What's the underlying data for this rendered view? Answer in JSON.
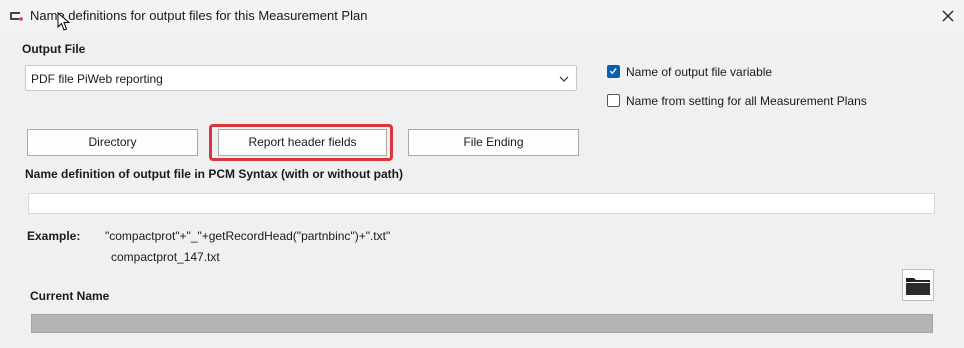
{
  "window": {
    "title": "Name definitions for output files for this Measurement Plan"
  },
  "output_file": {
    "label": "Output File",
    "selected": "PDF file PiWeb reporting"
  },
  "options": {
    "variable_label": "Name of output file variable",
    "variable_checked": true,
    "global_label": "Name from setting for all Measurement Plans",
    "global_checked": false
  },
  "buttons": {
    "directory": "Directory",
    "report_header": "Report header fields",
    "file_ending": "File Ending"
  },
  "definition": {
    "label": "Name definition of output file in PCM Syntax (with or without path)",
    "value": ""
  },
  "example": {
    "label": "Example:",
    "syntax": "\"compactprot\"+\"_\"+getRecordHead(\"partnbinc\")+\".txt\"",
    "result": "compactprot_147.txt"
  },
  "current_name": {
    "label": "Current Name",
    "value": ""
  },
  "colors": {
    "highlight": "#d9363e",
    "checkbox_accent": "#0a5fb4"
  },
  "icons": [
    "app-icon",
    "close-icon",
    "mouse-cursor-icon",
    "chevron-down-icon",
    "checkmark-icon",
    "folder-icon"
  ]
}
